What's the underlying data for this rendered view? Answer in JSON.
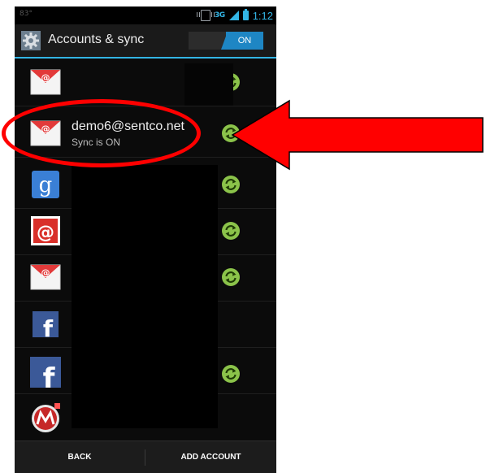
{
  "status_bar": {
    "left_text": "83°",
    "time": "1:12",
    "network": "3G"
  },
  "action_bar": {
    "title": "Accounts & sync",
    "toggle_label": "ON"
  },
  "accounts": [
    {
      "icon": "email-envelope-icon",
      "name": "",
      "subtitle": "",
      "sync": true
    },
    {
      "icon": "email-envelope-icon",
      "name": "demo6@sentco.net",
      "subtitle": "Sync is ON",
      "sync": true
    },
    {
      "icon": "google-icon",
      "name": "",
      "subtitle": "",
      "sync": true
    },
    {
      "icon": "email-stamp-icon",
      "name": "",
      "subtitle": "",
      "sync": true
    },
    {
      "icon": "email-envelope-icon",
      "name": "",
      "subtitle": "",
      "sync": true
    },
    {
      "icon": "facebook-icon",
      "name": "",
      "subtitle": "",
      "sync": false
    },
    {
      "icon": "facebook-icon",
      "name": "",
      "subtitle": "",
      "sync": true
    },
    {
      "icon": "motorola-icon",
      "name": "",
      "subtitle": "",
      "sync": false
    }
  ],
  "bottom_bar": {
    "back_label": "BACK",
    "add_label": "ADD ACCOUNT"
  },
  "colors": {
    "accent": "#33b5e5",
    "sync": "#8bc34a",
    "annotation": "#ff0000"
  }
}
